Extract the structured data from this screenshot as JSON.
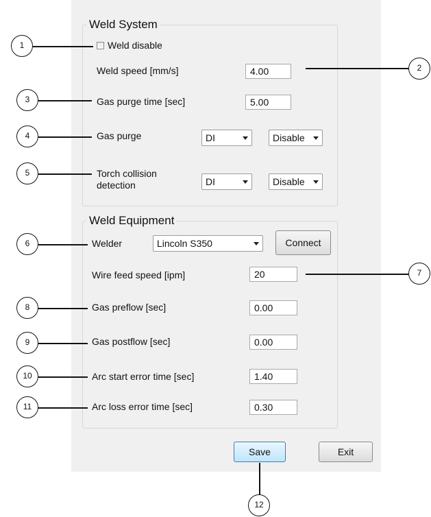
{
  "weld_system": {
    "title": "Weld System",
    "weld_disable": {
      "label": "Weld disable",
      "checked": false
    },
    "weld_speed": {
      "label": "Weld speed [mm/s]",
      "value": "4.00"
    },
    "gas_purge_time": {
      "label": "Gas purge time [sec]",
      "value": "5.00"
    },
    "gas_purge": {
      "label": "Gas purge",
      "source": "DI",
      "state": "Disable"
    },
    "torch_collision": {
      "label_line1": "Torch collision",
      "label_line2": "detection",
      "source": "DI",
      "state": "Disable"
    }
  },
  "weld_equipment": {
    "title": "Weld Equipment",
    "welder": {
      "label": "Welder",
      "value": "Lincoln S350",
      "connect_label": "Connect"
    },
    "wire_feed_speed": {
      "label": "Wire feed speed [ipm]",
      "value": "20"
    },
    "gas_preflow": {
      "label": "Gas preflow [sec]",
      "value": "0.00"
    },
    "gas_postflow": {
      "label": "Gas postflow [sec]",
      "value": "0.00"
    },
    "arc_start_error": {
      "label": "Arc start error time [sec]",
      "value": "1.40"
    },
    "arc_loss_error": {
      "label": "Arc loss error time [sec]",
      "value": "0.30"
    }
  },
  "footer": {
    "save_label": "Save",
    "exit_label": "Exit"
  },
  "callouts": [
    "1",
    "2",
    "3",
    "4",
    "5",
    "6",
    "7",
    "8",
    "9",
    "10",
    "11",
    "12"
  ]
}
